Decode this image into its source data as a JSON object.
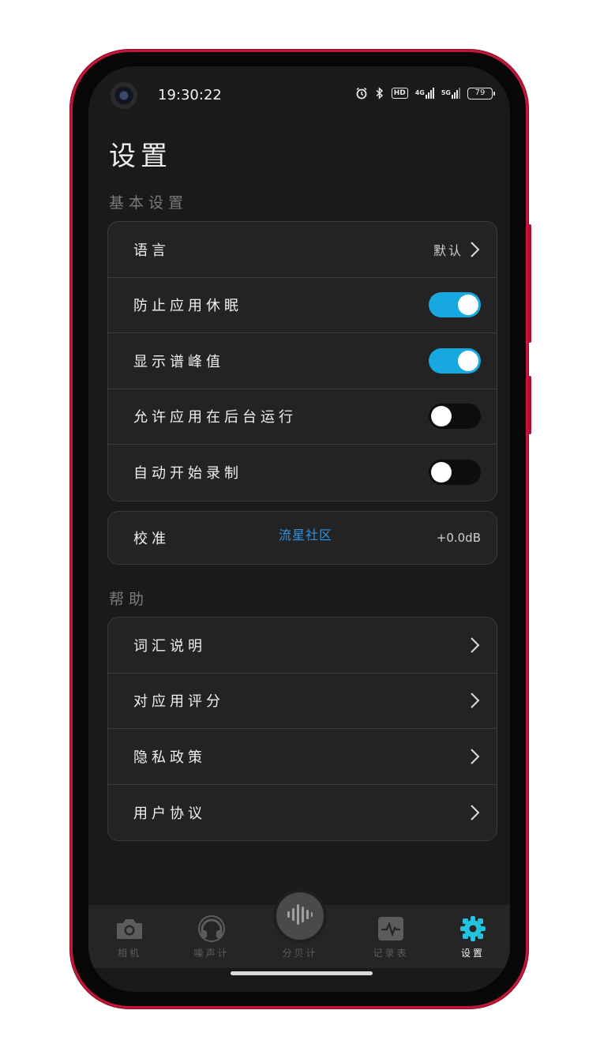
{
  "status_bar": {
    "time": "19:30:22",
    "hd_label": "HD",
    "network_1": "4G",
    "network_2": "5G",
    "battery": "79"
  },
  "page": {
    "title": "设置"
  },
  "sections": {
    "basic": {
      "title": "基本设置",
      "language": {
        "label": "语言",
        "value": "默认"
      },
      "toggles": [
        {
          "label": "防止应用休眠",
          "on": true
        },
        {
          "label": "显示谱峰值",
          "on": true
        },
        {
          "label": "允许应用在后台运行",
          "on": false
        },
        {
          "label": "自动开始录制",
          "on": false
        }
      ]
    },
    "calibration": {
      "label": "校准",
      "link": "流星社区",
      "value": "+0.0dB"
    },
    "help": {
      "title": "帮助",
      "items": [
        {
          "label": "词汇说明"
        },
        {
          "label": "对应用评分"
        },
        {
          "label": "隐私政策"
        },
        {
          "label": "用户协议"
        }
      ]
    }
  },
  "tab_bar": {
    "tabs": [
      {
        "label": "相机",
        "icon": "camera-icon",
        "active": false
      },
      {
        "label": "噪声计",
        "icon": "headphones-icon",
        "active": false
      },
      {
        "label": "分贝计",
        "icon": "sound-wave-icon",
        "active": false
      },
      {
        "label": "记录表",
        "icon": "pulse-chart-icon",
        "active": false
      },
      {
        "label": "设置",
        "icon": "gear-icon",
        "active": true
      }
    ],
    "accent_color": "#17a8e0",
    "active_icon_color": "#20c4e0"
  },
  "colors": {
    "background": "#1a1a1a",
    "card": "#232323",
    "toggle_on": "#17a8e0",
    "link": "#2f95e6",
    "phone_frame": "#c2163a"
  }
}
